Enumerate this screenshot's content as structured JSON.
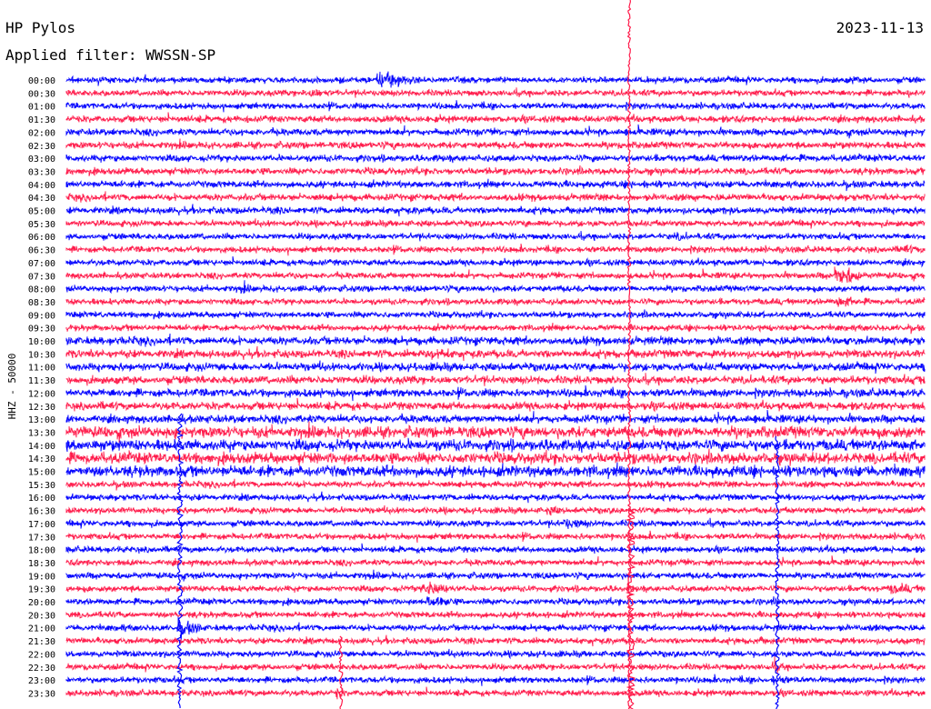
{
  "header": {
    "station": "HP Pylos",
    "date": "2023-11-13",
    "filter_text": "Applied filter: WWSSN-SP"
  },
  "chart_data": {
    "type": "line",
    "chart_kind": "helicorder",
    "ylabel": "HHZ - 50000",
    "row_labels": [
      "00:00",
      "00:30",
      "01:00",
      "01:30",
      "02:00",
      "02:30",
      "03:00",
      "03:30",
      "04:00",
      "04:30",
      "05:00",
      "05:30",
      "06:00",
      "06:30",
      "07:00",
      "07:30",
      "08:00",
      "08:30",
      "09:00",
      "09:30",
      "10:00",
      "10:30",
      "11:00",
      "11:30",
      "12:00",
      "12:30",
      "13:00",
      "13:30",
      "14:00",
      "14:30",
      "15:00",
      "15:30",
      "16:00",
      "16:30",
      "17:00",
      "17:30",
      "18:00",
      "18:30",
      "19:00",
      "19:30",
      "20:00",
      "20:30",
      "21:00",
      "21:30",
      "22:00",
      "22:30",
      "23:00",
      "23:30"
    ],
    "trace_colors": [
      "#0000ff",
      "#ff1a4a"
    ],
    "row_minutes": 30
  }
}
